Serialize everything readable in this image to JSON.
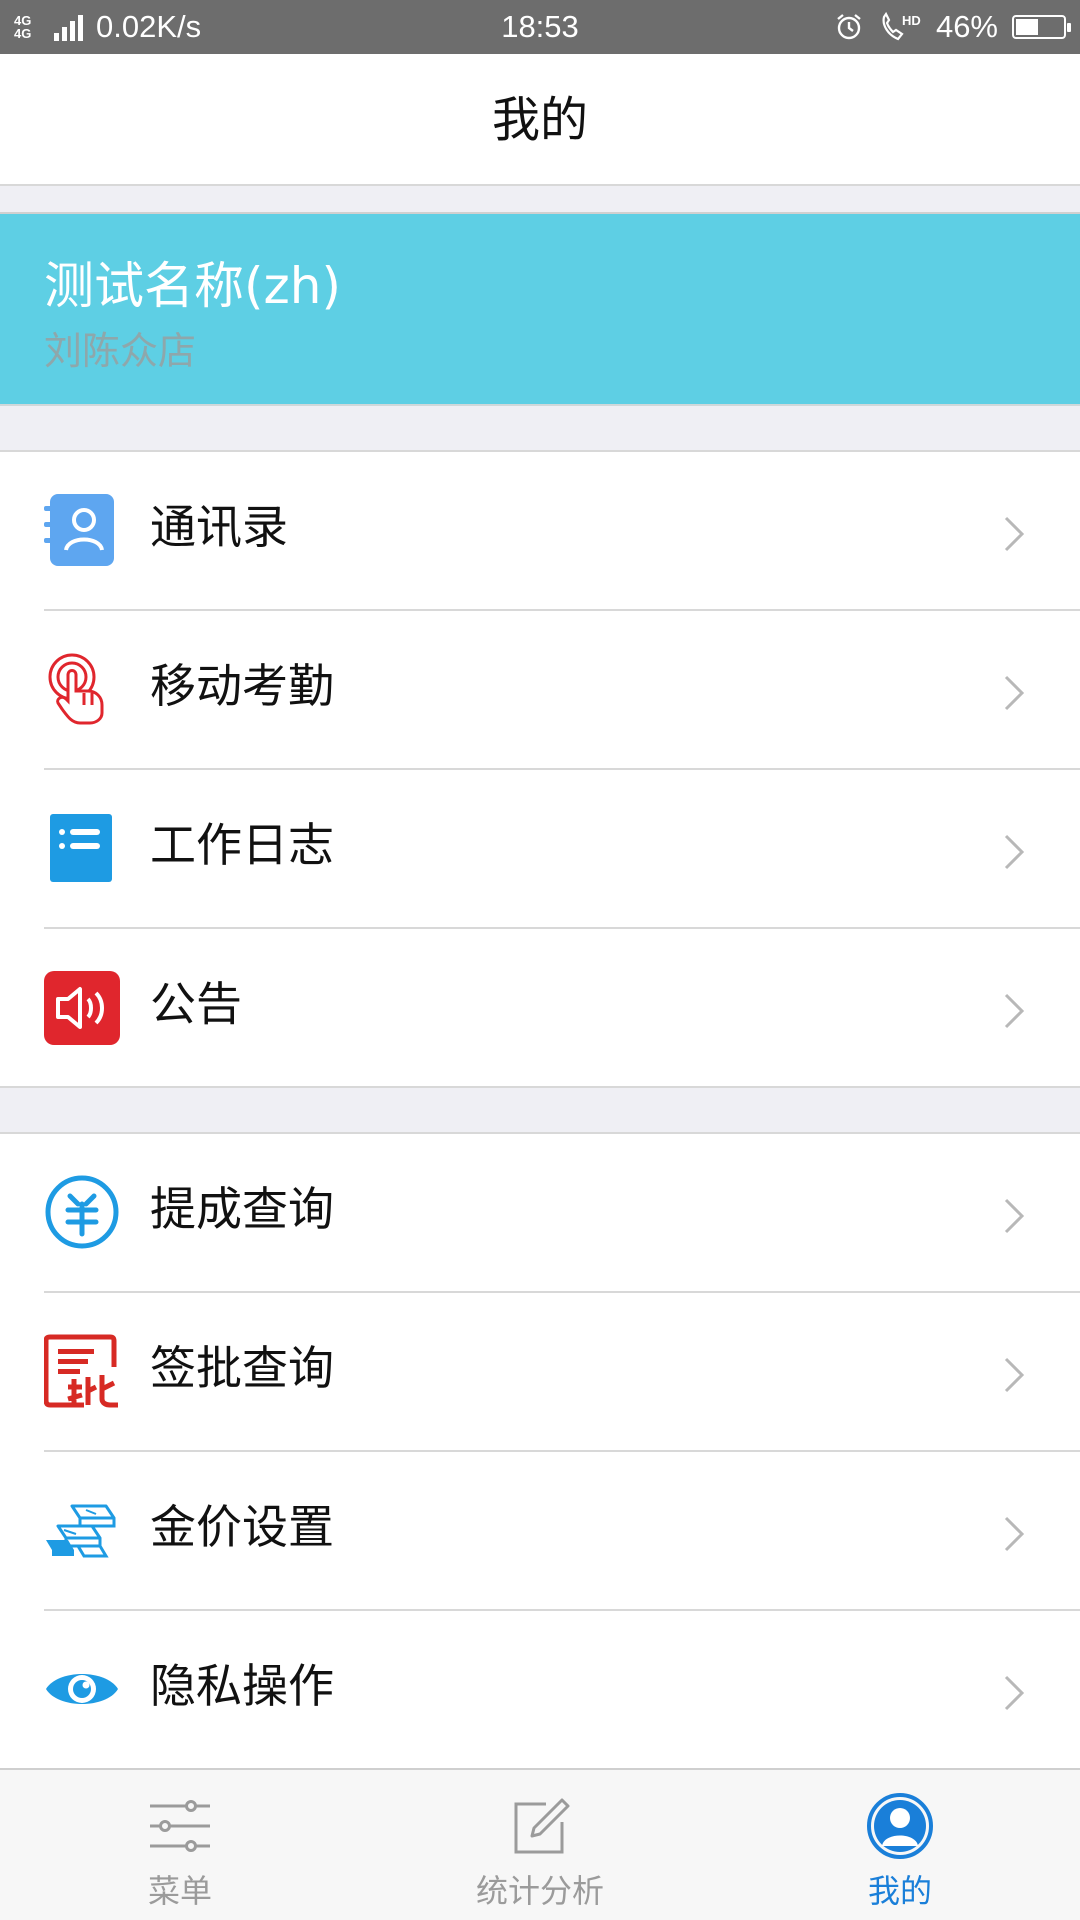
{
  "status_bar": {
    "network": "4G 4G",
    "speed": "0.02K/s",
    "time": "18:53",
    "call_hd": "HD",
    "battery": "46%",
    "icons": [
      "alarm-icon",
      "hd-call-icon",
      "battery-icon",
      "signal-icon"
    ]
  },
  "header": {
    "title": "我的"
  },
  "profile": {
    "name": "测试名称(zh)",
    "store": "刘陈众店"
  },
  "menu_group_1": [
    {
      "label": "通讯录",
      "icon": "contacts-icon"
    },
    {
      "label": "移动考勤",
      "icon": "touch-attendance-icon"
    },
    {
      "label": "工作日志",
      "icon": "work-log-icon"
    },
    {
      "label": "公告",
      "icon": "announcement-icon"
    }
  ],
  "menu_group_2": [
    {
      "label": "提成查询",
      "icon": "commission-icon"
    },
    {
      "label": "签批查询",
      "icon": "approval-icon"
    },
    {
      "label": "金价设置",
      "icon": "gold-bars-icon"
    },
    {
      "label": "隐私操作",
      "icon": "privacy-eye-icon"
    }
  ],
  "bottom_nav": [
    {
      "label": "菜单",
      "icon": "menu-sliders-icon",
      "active": false
    },
    {
      "label": "统计分析",
      "icon": "edit-note-icon",
      "active": false
    },
    {
      "label": "我的",
      "icon": "user-profile-icon",
      "active": true
    }
  ],
  "colors": {
    "profile_bg": "#5ecfe4",
    "accent_blue": "#1a7fd9",
    "icon_red": "#e0262d",
    "icon_blue": "#1e9be3"
  }
}
